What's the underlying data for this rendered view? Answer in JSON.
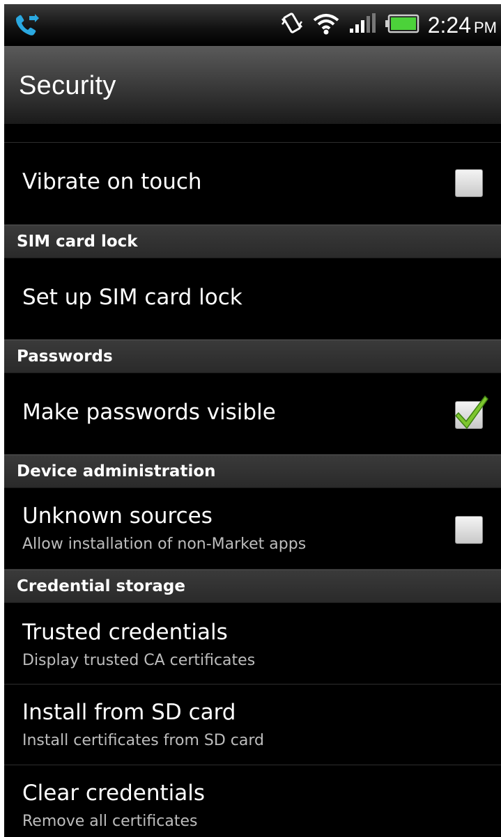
{
  "status_bar": {
    "time": "2:24",
    "ampm": "PM",
    "icons": [
      "call-forward-icon",
      "vibrate-icon",
      "wifi-icon",
      "signal-icon",
      "battery-icon"
    ]
  },
  "header": {
    "title": "Security"
  },
  "items": [
    {
      "label": "Vibrate on touch",
      "checked": false
    },
    {
      "section": "SIM card lock"
    },
    {
      "label": "Set up SIM card lock"
    },
    {
      "section": "Passwords"
    },
    {
      "label": "Make passwords visible",
      "checked": true
    },
    {
      "section": "Device administration"
    },
    {
      "label": "Unknown sources",
      "sub": "Allow installation of non-Market apps",
      "checked": false
    },
    {
      "section": "Credential storage"
    },
    {
      "label": "Trusted credentials",
      "sub": "Display trusted CA certificates"
    },
    {
      "label": "Install from SD card",
      "sub": "Install certificates from SD card"
    },
    {
      "label": "Clear credentials",
      "sub": "Remove all certificates"
    }
  ],
  "colors": {
    "checkmark": "#7dc62e",
    "background": "#000000",
    "section": "#333333"
  }
}
